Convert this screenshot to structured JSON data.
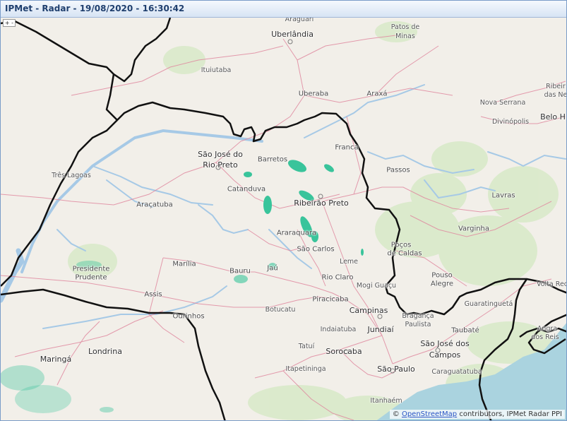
{
  "window": {
    "title": "IPMet - Radar - 19/08/2020 - 16:30:42"
  },
  "map": {
    "zoom_control_label": "+ -",
    "attribution": {
      "prefix": "© ",
      "link_text": "OpenStreetMap",
      "suffix": " contributors, IPMet Radar PPI"
    },
    "colors": {
      "land": "#f2efe9",
      "roads": "#e08aa0",
      "borders": "#111111",
      "rivers": "#a6c9e6",
      "ocean": "#aad3df",
      "vegetation": "#cfe5bd",
      "radar_echo": "#39c49b"
    },
    "labels": [
      {
        "text": "Araguari",
        "class": "town"
      },
      {
        "text": "Patos de",
        "class": "town"
      },
      {
        "text": "Minas",
        "class": "town"
      },
      {
        "text": "Uberlândia",
        "class": "city"
      },
      {
        "text": "Ituiutaba",
        "class": "town"
      },
      {
        "text": "Uberaba",
        "class": "town-bold"
      },
      {
        "text": "Araxá",
        "class": "town-bold"
      },
      {
        "text": "Ribeir",
        "class": "town"
      },
      {
        "text": "das Ne",
        "class": "town"
      },
      {
        "text": "Nova Serrana",
        "class": "town"
      },
      {
        "text": "Belo H",
        "class": "city"
      },
      {
        "text": "Divinópolis",
        "class": "town"
      },
      {
        "text": "Franca",
        "class": "town-bold"
      },
      {
        "text": "São José do",
        "class": "city"
      },
      {
        "text": "Rio Preto",
        "class": "city"
      },
      {
        "text": "Barretos",
        "class": "town-bold"
      },
      {
        "text": "Passos",
        "class": "town-bold"
      },
      {
        "text": "Três Lagoas",
        "class": "town"
      },
      {
        "text": "Catanduva",
        "class": "town-bold"
      },
      {
        "text": "Ribeirão Preto",
        "class": "city"
      },
      {
        "text": "Lavras",
        "class": "town-bold"
      },
      {
        "text": "Araçatuba",
        "class": "town-bold"
      },
      {
        "text": "Varginha",
        "class": "town-bold"
      },
      {
        "text": "Araraquara",
        "class": "town-bold"
      },
      {
        "text": "São Carlos",
        "class": "town-bold"
      },
      {
        "text": "Poços",
        "class": "town-bold"
      },
      {
        "text": "de Caldas",
        "class": "town-bold"
      },
      {
        "text": "Presidente",
        "class": "town-bold"
      },
      {
        "text": "Prudente",
        "class": "town-bold"
      },
      {
        "text": "Marília",
        "class": "town-bold"
      },
      {
        "text": "Bauru",
        "class": "town-bold"
      },
      {
        "text": "Jaú",
        "class": "town-bold"
      },
      {
        "text": "Leme",
        "class": "town"
      },
      {
        "text": "Rio Claro",
        "class": "town-bold"
      },
      {
        "text": "Mogi Guaçu",
        "class": "town"
      },
      {
        "text": "Pouso",
        "class": "town-bold"
      },
      {
        "text": "Alegre",
        "class": "town-bold"
      },
      {
        "text": "Volta Rec",
        "class": "town"
      },
      {
        "text": "Assis",
        "class": "town-bold"
      },
      {
        "text": "Piracicaba",
        "class": "town-bold"
      },
      {
        "text": "Campinas",
        "class": "city"
      },
      {
        "text": "Guaratinguetá",
        "class": "town"
      },
      {
        "text": "Ourinhos",
        "class": "town-bold"
      },
      {
        "text": "Botucatu",
        "class": "town"
      },
      {
        "text": "Bragança",
        "class": "town"
      },
      {
        "text": "Paulista",
        "class": "town"
      },
      {
        "text": "Taubaté",
        "class": "town-bold"
      },
      {
        "text": "Angra",
        "class": "town"
      },
      {
        "text": "dos Reis",
        "class": "town"
      },
      {
        "text": "Indaiatuba",
        "class": "town"
      },
      {
        "text": "Jundiaí",
        "class": "city"
      },
      {
        "text": "São José dos",
        "class": "city"
      },
      {
        "text": "Campos",
        "class": "city"
      },
      {
        "text": "Londrina",
        "class": "city"
      },
      {
        "text": "Tatuí",
        "class": "town"
      },
      {
        "text": "Sorocaba",
        "class": "city"
      },
      {
        "text": "Maringá",
        "class": "city"
      },
      {
        "text": "São Paulo",
        "class": "city"
      },
      {
        "text": "Itapetininga",
        "class": "town"
      },
      {
        "text": "Caraguatatuba",
        "class": "town"
      },
      {
        "text": "Itanhaém",
        "class": "town"
      }
    ]
  }
}
